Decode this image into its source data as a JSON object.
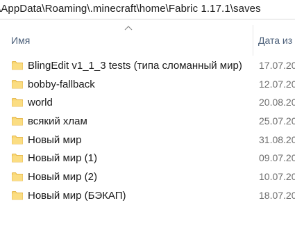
{
  "address_bar": {
    "path": "\\AppData\\Roaming\\.minecraft\\home\\Fabric 1.17.1\\saves"
  },
  "columns": {
    "name": "Имя",
    "date_modified": "Дата из"
  },
  "files": [
    {
      "name": "BlingEdit v1_1_3 tests (типа сломанный мир)",
      "date": "17.07.20",
      "icon": "folder-icon"
    },
    {
      "name": "bobby-fallback",
      "date": "12.07.20",
      "icon": "folder-icon"
    },
    {
      "name": "world",
      "date": "20.08.20",
      "icon": "folder-icon"
    },
    {
      "name": "всякий хлам",
      "date": "25.07.20",
      "icon": "folder-icon"
    },
    {
      "name": "Новый мир",
      "date": "31.08.20",
      "icon": "folder-icon"
    },
    {
      "name": "Новый мир (1)",
      "date": "09.07.20",
      "icon": "folder-icon"
    },
    {
      "name": "Новый мир (2)",
      "date": "10.07.20",
      "icon": "folder-icon"
    },
    {
      "name": "Новый мир (БЭКАП)",
      "date": "18.07.20",
      "icon": "folder-icon"
    }
  ],
  "colors": {
    "folder": "#f8d775",
    "folder_dark": "#e8b13a",
    "header_text": "#4c607a"
  }
}
